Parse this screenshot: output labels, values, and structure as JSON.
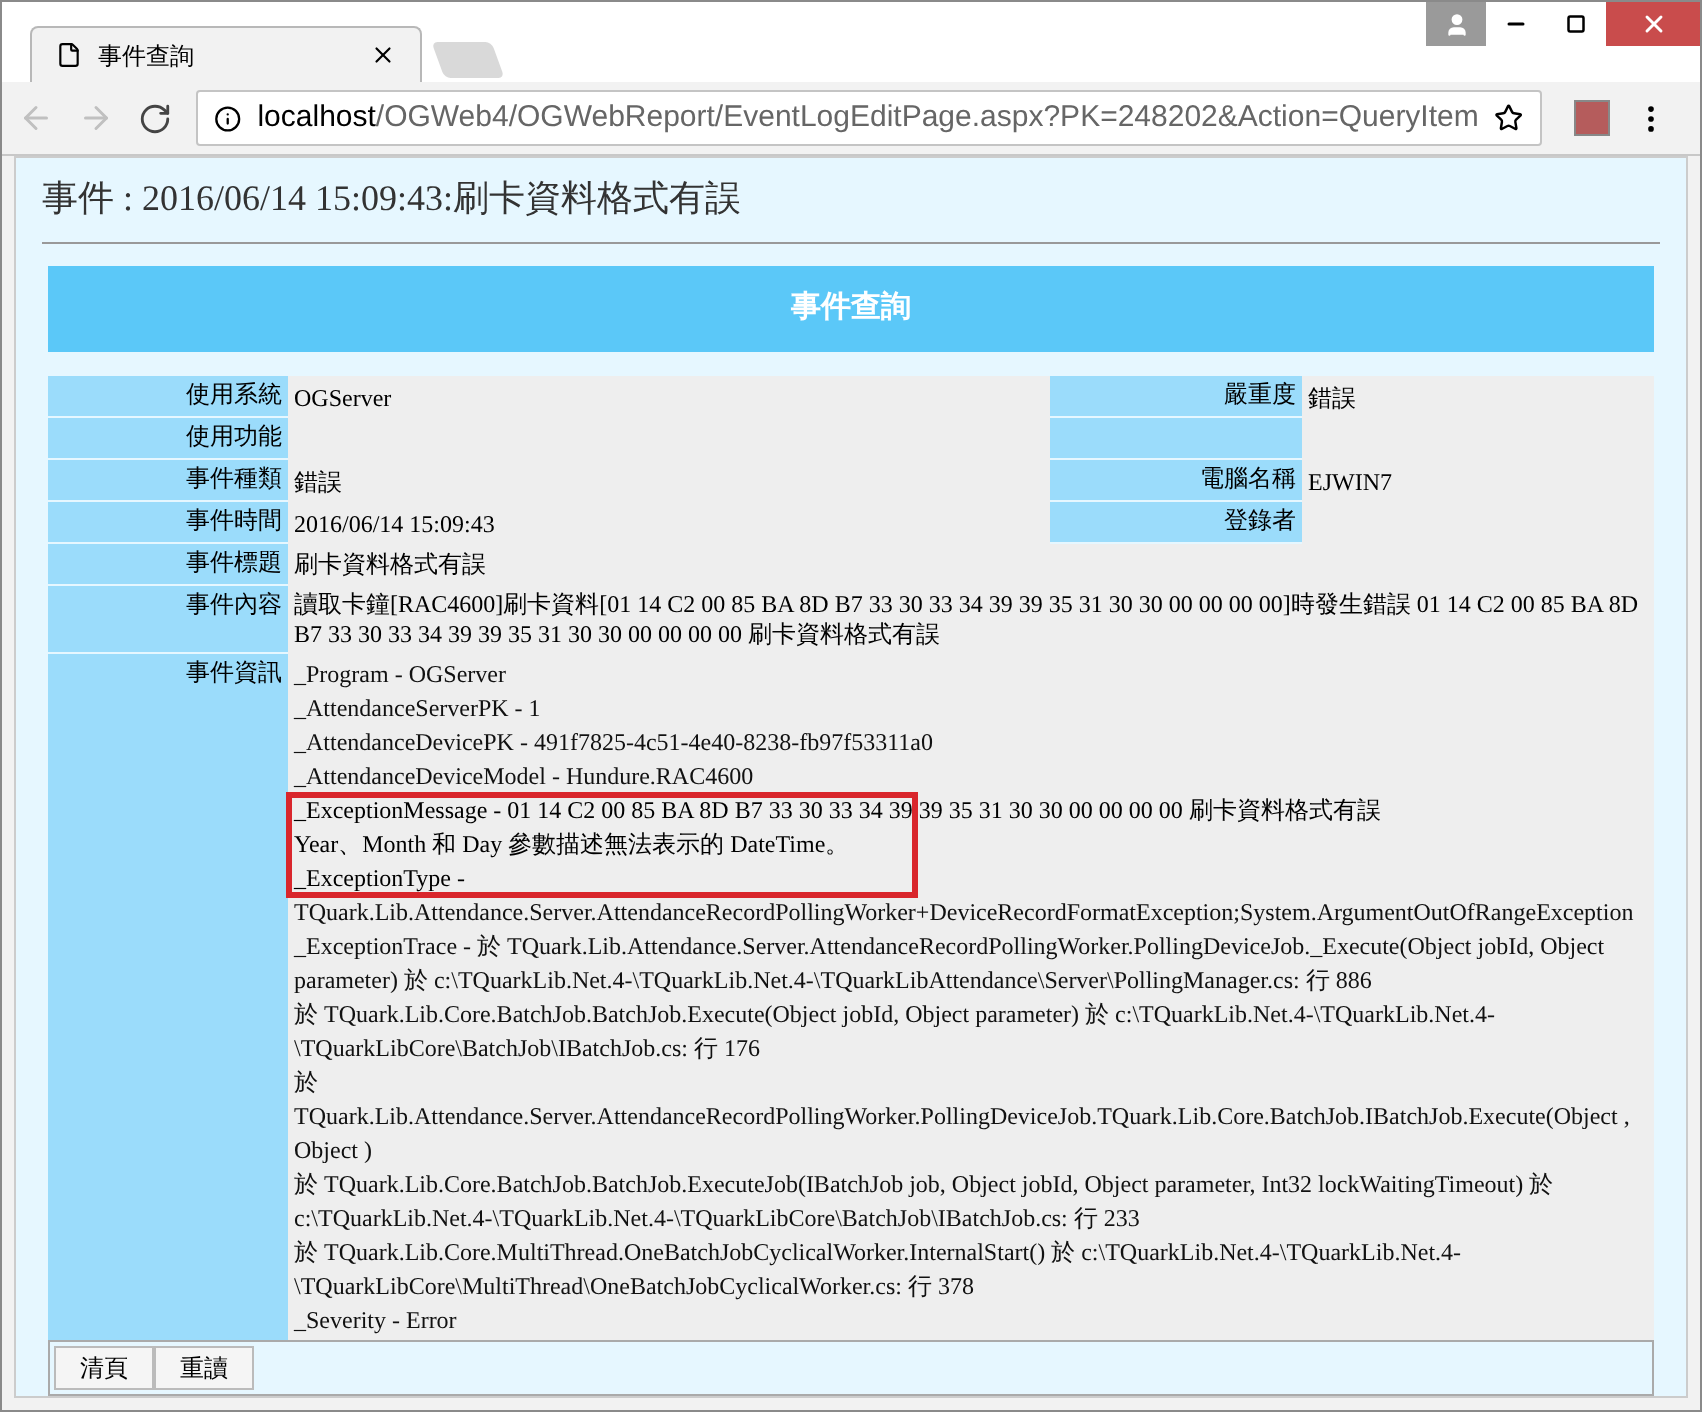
{
  "browser": {
    "tab": {
      "title": "事件查詢",
      "selected": true
    },
    "url_host": "localhost",
    "url_path": "/OGWeb4/OGWebReport/EventLogEditPage.aspx?PK=248202&Action=QueryItem"
  },
  "page": {
    "title": "事件 : 2016/06/14 15:09:43:刷卡資料格式有誤",
    "header": "事件查詢",
    "rows": [
      {
        "kind": "pair",
        "label": "使用系統",
        "value": "OGServer",
        "label2": "嚴重度",
        "value2": "錯誤"
      },
      {
        "kind": "pair",
        "label": "使用功能"
      },
      {
        "kind": "pair",
        "label": "事件種類",
        "value": "錯誤",
        "label2": "電腦名稱",
        "value2": "EJWIN7"
      },
      {
        "kind": "pair",
        "label": "事件時間",
        "value": "2016/06/14 15:09:43",
        "label2": "登錄者"
      },
      {
        "kind": "wide",
        "label": "事件標題",
        "value": "刷卡資料格式有誤"
      },
      {
        "kind": "wide",
        "label": "事件內容",
        "value": "讀取卡鐘[RAC4600]刷卡資料[01 14 C2 00 85 BA 8D B7 33 30 33 34 39 39 35 31 30 30 00 00 00 00]時發生錯誤 01 14 C2 00 85 BA 8D B7 33 30 33 34 39 39 35 31 30 30 00 00 00 00 刷卡資料格式有誤"
      },
      {
        "kind": "info",
        "label": "事件資訊",
        "lines": [
          {
            "text": "_Program - OGServer",
            "highlighted": false
          },
          {
            "text": "_AttendanceServerPK - 1",
            "highlighted": false
          },
          {
            "text": "_AttendanceDevicePK - 491f7825-4c51-4e40-8238-fb97f53311a0",
            "highlighted": false
          },
          {
            "text": "_AttendanceDeviceModel - Hundure.RAC4600",
            "highlighted": false
          },
          {
            "text": "_ExceptionMessage - 01 14 C2 00 85 BA 8D B7 33 30 33 34 39 39 35 31 30 30 00 00 00 00 刷卡資料格式有誤",
            "highlighted": true
          },
          {
            "text": "Year、Month 和 Day 參數描述無法表示的 DateTime。",
            "highlighted": true
          },
          {
            "text": "_ExceptionType -",
            "highlighted": true
          },
          {
            "text": "TQuark.Lib.Attendance.Server.AttendanceRecordPollingWorker+DeviceRecordFormatException;System.ArgumentOutOfRangeException",
            "highlighted": false
          },
          {
            "text": "_ExceptionTrace - 於 TQuark.Lib.Attendance.Server.AttendanceRecordPollingWorker.PollingDeviceJob._Execute(Object jobId, Object parameter) 於 c:\\TQuarkLib.Net.4-\\TQuarkLib.Net.4-\\TQuarkLibAttendance\\Server\\PollingManager.cs: 行 886",
            "highlighted": false
          },
          {
            "text": "於 TQuark.Lib.Core.BatchJob.BatchJob.Execute(Object jobId, Object parameter) 於 c:\\TQuarkLib.Net.4-\\TQuarkLib.Net.4-\\TQuarkLibCore\\BatchJob\\IBatchJob.cs: 行 176",
            "highlighted": false
          },
          {
            "text": "於",
            "highlighted": false
          },
          {
            "text": "TQuark.Lib.Attendance.Server.AttendanceRecordPollingWorker.PollingDeviceJob.TQuark.Lib.Core.BatchJob.IBatchJob.Execute(Object , Object )",
            "highlighted": false
          },
          {
            "text": "於 TQuark.Lib.Core.BatchJob.BatchJob.ExecuteJob(IBatchJob job, Object jobId, Object parameter, Int32 lockWaitingTimeout) 於 c:\\TQuarkLib.Net.4-\\TQuarkLib.Net.4-\\TQuarkLibCore\\BatchJob\\IBatchJob.cs: 行 233",
            "highlighted": false
          },
          {
            "text": "於 TQuark.Lib.Core.MultiThread.OneBatchJobCyclicalWorker.InternalStart() 於 c:\\TQuarkLib.Net.4-\\TQuarkLib.Net.4-\\TQuarkLibCore\\MultiThread\\OneBatchJobCyclicalWorker.cs: 行 378",
            "highlighted": false
          },
          {
            "text": "_Severity - Error",
            "highlighted": false
          }
        ]
      }
    ],
    "buttons": [
      "清頁",
      "重讀"
    ]
  }
}
